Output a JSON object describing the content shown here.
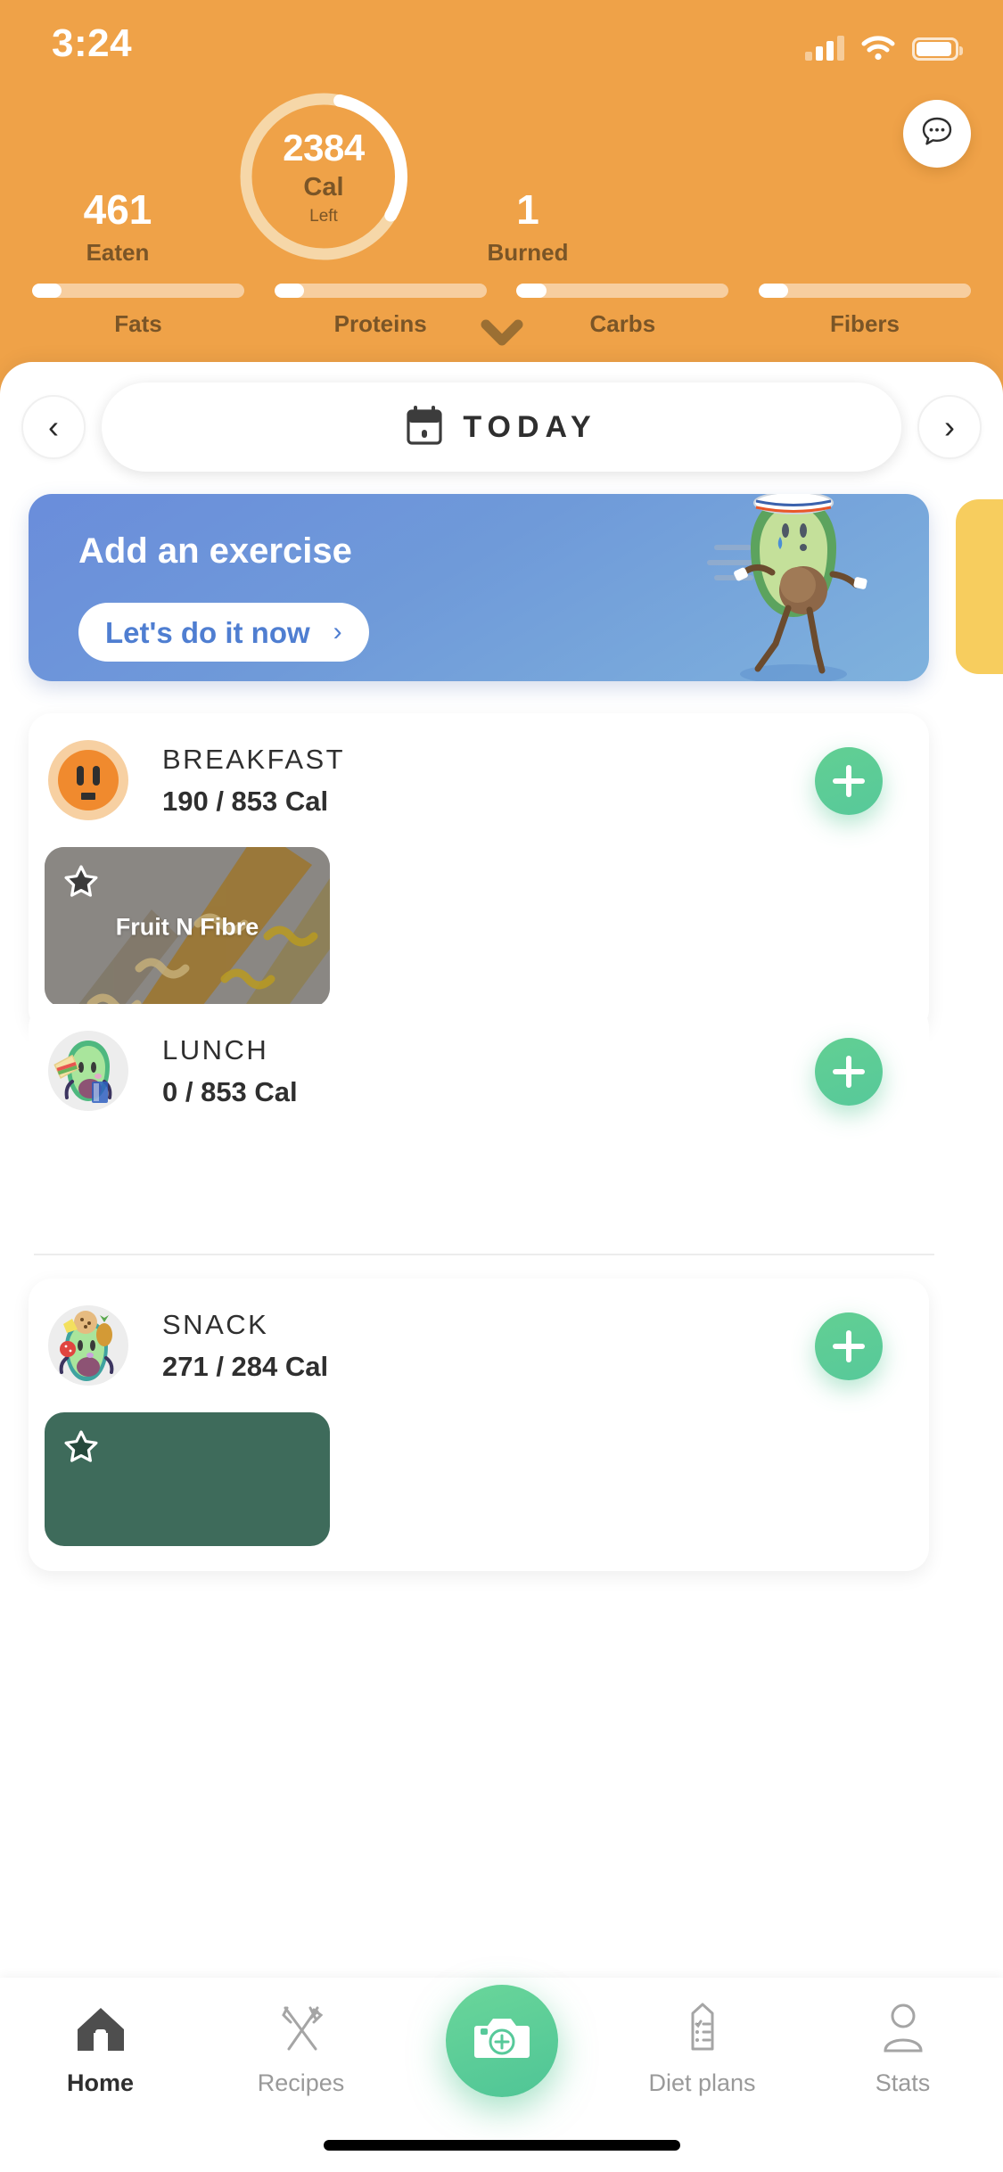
{
  "status_bar": {
    "time": "3:24",
    "signal_icon": "cellular-signal-icon",
    "wifi_icon": "wifi-icon",
    "battery_icon": "battery-icon"
  },
  "header": {
    "calorie_ring": {
      "value": "2384",
      "unit": "Cal",
      "suffix": "Left",
      "progress_percent": 30
    },
    "eaten": {
      "value": "461",
      "label": "Eaten"
    },
    "burned": {
      "value": "1",
      "label": "Burned"
    },
    "chat_icon": "chat-bubble-icon",
    "expand_icon": "chevron-down-icon",
    "macros": [
      {
        "name": "Fats",
        "percent": 14
      },
      {
        "name": "Proteins",
        "percent": 14
      },
      {
        "name": "Carbs",
        "percent": 14
      },
      {
        "name": "Fibers",
        "percent": 14
      }
    ]
  },
  "date_nav": {
    "prev_label": "‹",
    "next_label": "›",
    "current": "TODAY",
    "calendar_icon": "calendar-icon"
  },
  "promo": {
    "title": "Add an exercise",
    "button_label": "Let's do it now",
    "button_chevron": "›",
    "mascot_icon": "running-avocado-icon"
  },
  "meals": [
    {
      "name": "BREAKFAST",
      "calories": "190 / 853 Cal",
      "icon": "breakfast-face-icon",
      "add_label": "add",
      "items": [
        {
          "title": "Fruit N Fibre",
          "favorite": true,
          "image": "cereal-photo"
        }
      ]
    },
    {
      "name": "LUNCH",
      "calories": "0 / 853 Cal",
      "icon": "lunch-avocado-icon",
      "add_label": "add",
      "items": []
    },
    {
      "name": "SNACK",
      "calories": "271 / 284 Cal",
      "icon": "snack-avocado-icon",
      "add_label": "add",
      "items": [
        {
          "title": "",
          "favorite": true,
          "image": "snack-photo"
        }
      ]
    }
  ],
  "tabbar": {
    "items": [
      {
        "label": "Home",
        "icon": "home-icon",
        "active": true
      },
      {
        "label": "Recipes",
        "icon": "fork-knife-icon",
        "active": false
      },
      {
        "label": "Diet plans",
        "icon": "clipboard-icon",
        "active": false
      },
      {
        "label": "Stats",
        "icon": "person-icon",
        "active": false
      }
    ],
    "camera_icon": "camera-add-icon"
  },
  "colors": {
    "header_orange": "#efa248",
    "accent_green": "#57c99a",
    "promo_blue": "#6f9ad9",
    "promo_next_yellow": "#f7cd5e",
    "dark_text": "#2f2f2f",
    "brown_text": "#7a5527"
  }
}
